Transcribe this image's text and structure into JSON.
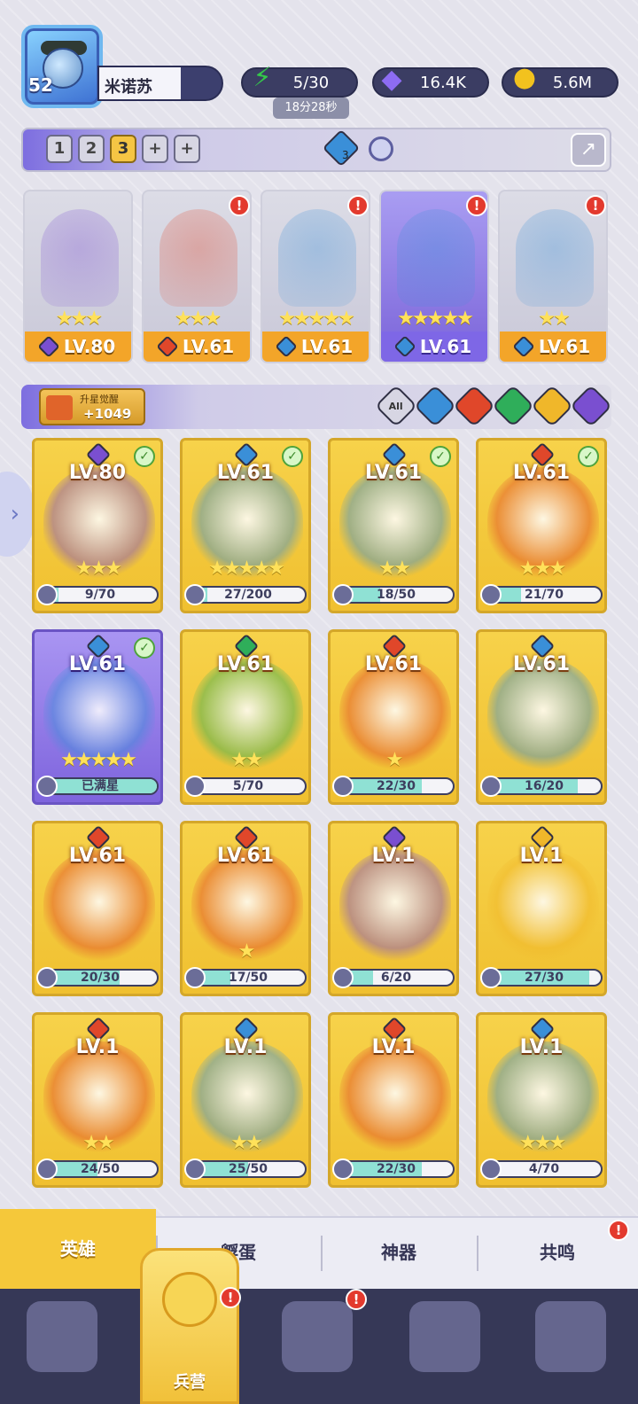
{
  "player": {
    "level": "52",
    "name": "米诺苏"
  },
  "resources": {
    "energy": {
      "icon": "energy-bolt-icon",
      "value": "5/30",
      "timer": "18分28秒"
    },
    "gems": {
      "icon": "diamond-icon",
      "value": "16.4K"
    },
    "coins": {
      "icon": "gold-coin-icon",
      "value": "5.6M"
    }
  },
  "teams": {
    "tabs": [
      "1",
      "2",
      "3",
      "+",
      "+"
    ],
    "active_index": 2,
    "element_badge": "3"
  },
  "team_heroes": [
    {
      "level": "LV.80",
      "element": "dark",
      "stars": "★★★",
      "alert": false,
      "highlight": false
    },
    {
      "level": "LV.61",
      "element": "fire",
      "stars": "★★★",
      "alert": true,
      "highlight": false
    },
    {
      "level": "LV.61",
      "element": "water",
      "stars": "★★★★★",
      "alert": true,
      "highlight": false
    },
    {
      "level": "LV.61",
      "element": "water",
      "stars": "★★★★★",
      "alert": true,
      "highlight": true
    },
    {
      "level": "LV.61",
      "element": "water",
      "stars": "★★",
      "alert": true,
      "highlight": false
    }
  ],
  "awaken": {
    "label": "升星觉醒",
    "value": "+1049"
  },
  "filters": [
    "All",
    "water",
    "fire",
    "wind",
    "light",
    "dark"
  ],
  "hero_grid": [
    {
      "level": "LV.80",
      "element": "dark",
      "stars": "★★★",
      "progress": "9/70",
      "fill": 0.13,
      "check": true,
      "purple": false
    },
    {
      "level": "LV.61",
      "element": "water",
      "stars": "★★★★★",
      "progress": "27/200",
      "fill": 0.14,
      "check": true,
      "purple": false
    },
    {
      "level": "LV.61",
      "element": "water",
      "stars": "★★",
      "progress": "18/50",
      "fill": 0.36,
      "check": true,
      "purple": false
    },
    {
      "level": "LV.61",
      "element": "fire",
      "stars": "★★★",
      "progress": "21/70",
      "fill": 0.3,
      "check": true,
      "purple": false
    },
    {
      "level": "LV.61",
      "element": "water",
      "stars": "★★★★★",
      "progress": "已满星",
      "fill": 1.0,
      "check": true,
      "purple": true
    },
    {
      "level": "LV.61",
      "element": "wind",
      "stars": "★★",
      "progress": "5/70",
      "fill": 0.07,
      "check": false,
      "purple": false
    },
    {
      "level": "LV.61",
      "element": "fire",
      "stars": "★",
      "progress": "22/30",
      "fill": 0.73,
      "check": false,
      "purple": false
    },
    {
      "level": "LV.61",
      "element": "water",
      "stars": "",
      "progress": "16/20",
      "fill": 0.8,
      "check": false,
      "purple": false
    },
    {
      "level": "LV.61",
      "element": "fire",
      "stars": "",
      "progress": "20/30",
      "fill": 0.67,
      "check": false,
      "purple": false
    },
    {
      "level": "LV.61",
      "element": "fire",
      "stars": "★",
      "progress": "17/50",
      "fill": 0.34,
      "check": false,
      "purple": false
    },
    {
      "level": "LV.1",
      "element": "dark",
      "stars": "",
      "progress": "6/20",
      "fill": 0.3,
      "check": false,
      "purple": false
    },
    {
      "level": "LV.1",
      "element": "light",
      "stars": "",
      "progress": "27/30",
      "fill": 0.9,
      "check": false,
      "purple": false
    },
    {
      "level": "LV.1",
      "element": "fire",
      "stars": "★★",
      "progress": "24/50",
      "fill": 0.48,
      "check": false,
      "purple": false
    },
    {
      "level": "LV.1",
      "element": "water",
      "stars": "★★",
      "progress": "25/50",
      "fill": 0.5,
      "check": false,
      "purple": false
    },
    {
      "level": "LV.1",
      "element": "fire",
      "stars": "",
      "progress": "22/30",
      "fill": 0.73,
      "check": false,
      "purple": false
    },
    {
      "level": "LV.1",
      "element": "water",
      "stars": "★★★",
      "progress": "4/70",
      "fill": 0.06,
      "check": false,
      "purple": false
    }
  ],
  "tabs": [
    {
      "label": "英雄",
      "active": true,
      "alert": false
    },
    {
      "label": "孵蛋",
      "active": false,
      "alert": false
    },
    {
      "label": "神器",
      "active": false,
      "alert": false
    },
    {
      "label": "共鸣",
      "active": false,
      "alert": true
    }
  ],
  "nav": [
    {
      "icon": "cards-icon",
      "label": "",
      "alert": false
    },
    {
      "icon": "barracks-icon",
      "label": "兵营",
      "alert": true,
      "active": true
    },
    {
      "icon": "map-icon",
      "label": "",
      "alert": true
    },
    {
      "icon": "castle-icon",
      "label": "",
      "alert": false
    },
    {
      "icon": "mushroom-icon",
      "label": "",
      "alert": false
    }
  ],
  "colors": {
    "water": "#3a8fd8",
    "fire": "#e0472a",
    "wind": "#2fae5a",
    "light": "#f0b72a",
    "dark": "#7a4fd0",
    "gold": "#f3a529"
  }
}
